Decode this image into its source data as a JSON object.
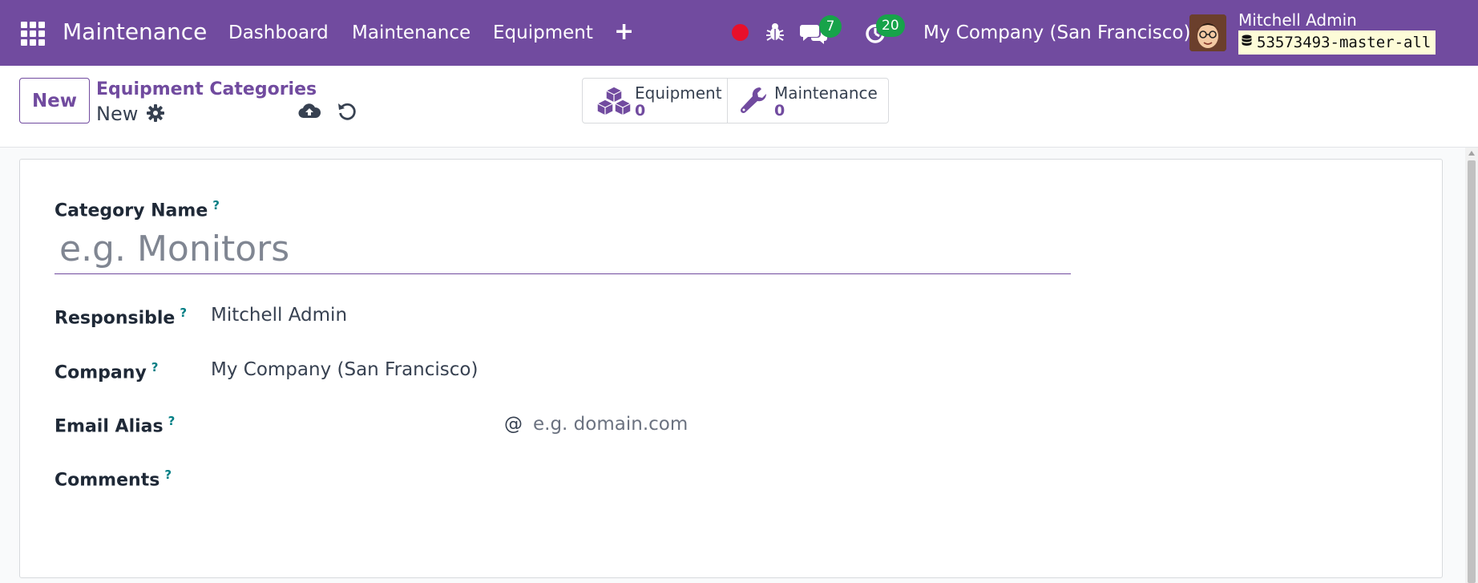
{
  "navbar": {
    "brand": "Maintenance",
    "menu": [
      "Dashboard",
      "Maintenance",
      "Equipment"
    ],
    "messages_badge": "7",
    "activities_badge": "20",
    "company": "My Company (San Francisco)",
    "user_name": "Mitchell Admin",
    "database": "53573493-master-all",
    "icons": [
      "apps-grid-icon",
      "plus-icon",
      "record-icon",
      "bug-icon",
      "chat-icon",
      "clock-icon",
      "database-icon"
    ]
  },
  "control_panel": {
    "new_label": "New",
    "breadcrumb_parent": "Equipment Categories",
    "breadcrumb_current": "New",
    "smart_buttons": [
      {
        "label": "Equipment",
        "value": "0"
      },
      {
        "label": "Maintenance",
        "value": "0"
      }
    ]
  },
  "form": {
    "category_name_label": "Category Name",
    "category_name_placeholder": "e.g. Monitors",
    "help_mark": "?",
    "responsible_label": "Responsible",
    "responsible_value": "Mitchell Admin",
    "company_label": "Company",
    "company_value": "My Company (San Francisco)",
    "email_alias_label": "Email Alias",
    "email_alias_at": "@",
    "email_alias_placeholder": "e.g. domain.com",
    "comments_label": "Comments"
  },
  "colors": {
    "brand": "#714b9f",
    "badge": "#17a34a",
    "record": "#e8102b",
    "help": "#017e84"
  }
}
